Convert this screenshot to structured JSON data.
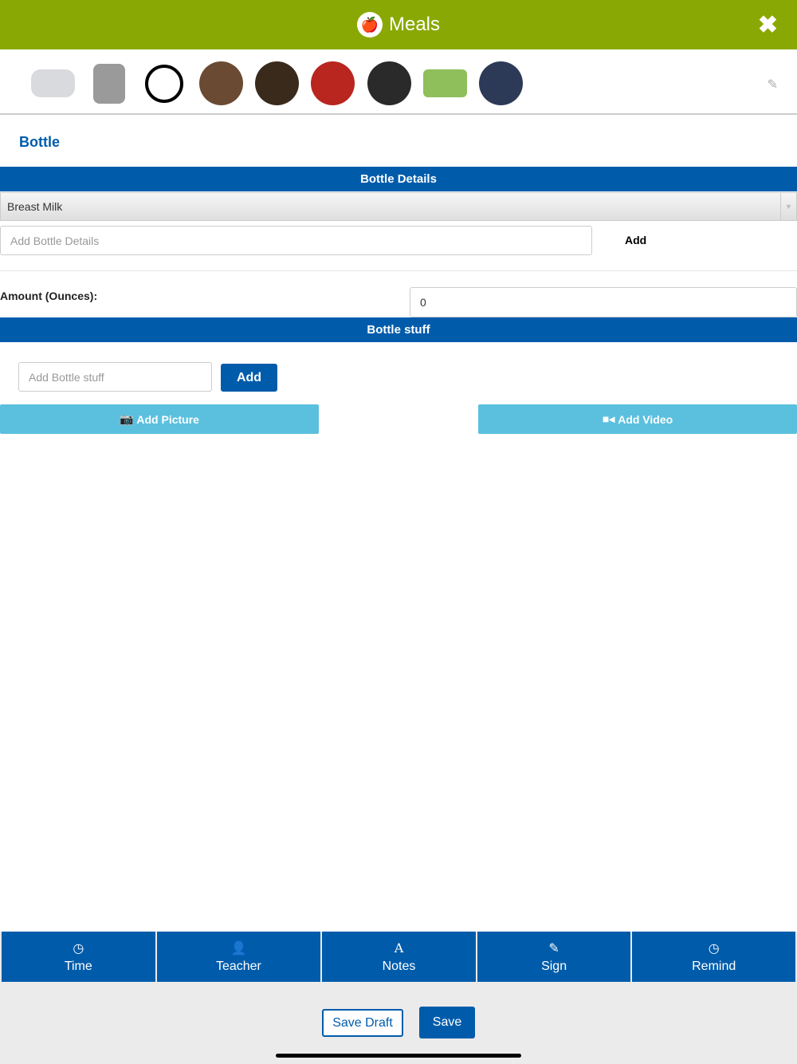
{
  "header": {
    "title": "Meals",
    "logo": "apple-bottle-icon",
    "close": "close-icon"
  },
  "avatars": [
    {
      "color": "#d8dade"
    },
    {
      "color": "#9a9a9a"
    },
    {
      "color": "#ffffff"
    },
    {
      "color": "#6b4a33"
    },
    {
      "color": "#3a2a1c"
    },
    {
      "color": "#b8261f"
    },
    {
      "color": "#2a2a2a"
    },
    {
      "color": "#8fbf5a"
    },
    {
      "color": "#2c3a58"
    }
  ],
  "section": {
    "title": "Bottle"
  },
  "bottle_details": {
    "header": "Bottle Details",
    "selected": "Breast Milk",
    "placeholder": "Add Bottle Details",
    "add_label": "Add"
  },
  "amount": {
    "label": "Amount (Ounces):",
    "value": "0"
  },
  "bottle_stuff": {
    "header": "Bottle stuff",
    "placeholder": "Add Bottle stuff",
    "add_label": "Add"
  },
  "media": {
    "picture": "Add Picture",
    "video": "Add Video"
  },
  "tabs": [
    {
      "label": "Time",
      "icon": "clock-icon"
    },
    {
      "label": "Teacher",
      "icon": "user-icon"
    },
    {
      "label": "Notes",
      "icon": "font-icon"
    },
    {
      "label": "Sign",
      "icon": "pencil-icon"
    },
    {
      "label": "Remind",
      "icon": "clock-icon"
    }
  ],
  "footer": {
    "save_draft": "Save Draft",
    "save": "Save"
  }
}
